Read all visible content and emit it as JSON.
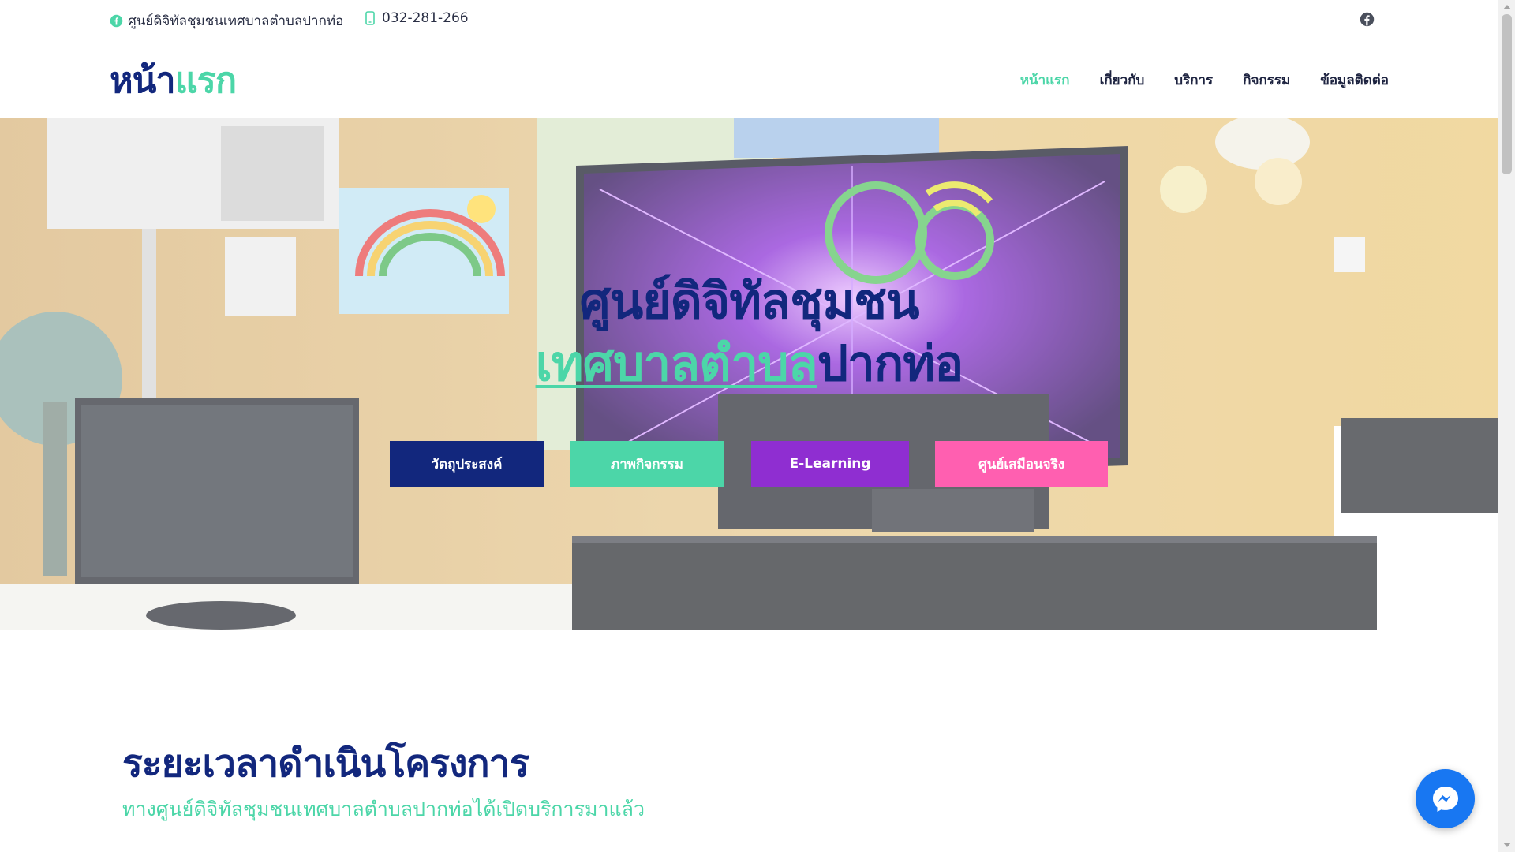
{
  "topbar": {
    "facebook_page": "ศูนย์ดิจิทัลชุมชนเทศบาลตำบลปากท่อ",
    "phone": "032-281-266",
    "icons": {
      "facebook": "facebook-icon",
      "phone": "phone-icon"
    }
  },
  "header": {
    "logo_part1": "หน้า",
    "logo_part2": "แรก",
    "nav": [
      {
        "label": "หน้าแรก",
        "active": true
      },
      {
        "label": "เกี่ยวกับ",
        "active": false
      },
      {
        "label": "บริการ",
        "active": false
      },
      {
        "label": "กิจกรรม",
        "active": false
      },
      {
        "label": "ข้อมูลติดต่อ",
        "active": false
      }
    ]
  },
  "hero": {
    "title_line1": "ศูนย์ดิจิทัลชุมชน",
    "title_line2_accent": "เทศบาลตำบล",
    "title_line2_rest": "ปากท่อ",
    "buttons": [
      {
        "label": "วัตถุประสงค์",
        "color": "#12277d"
      },
      {
        "label": "ภาพกิจกรรม",
        "color": "#4cd6a8"
      },
      {
        "label": "E-Learning",
        "color": "#8f2ed1"
      },
      {
        "label": "ศูนย์เสมือนจริง",
        "color": "#ff5fb0"
      }
    ]
  },
  "section": {
    "title": "ระยะเวลาดำเนินโครงการ",
    "subtitle": "ทางศูนย์ดิจิทัลชุมชนเทศบาลตำบลปากท่อได้เปิดบริการมาแล้ว"
  },
  "colors": {
    "primary": "#12277d",
    "accent": "#4cd6a8",
    "purple": "#8f2ed1",
    "pink": "#ff5fb0",
    "messenger": "#1877f2"
  },
  "widgets": {
    "messenger": "messenger-icon"
  }
}
